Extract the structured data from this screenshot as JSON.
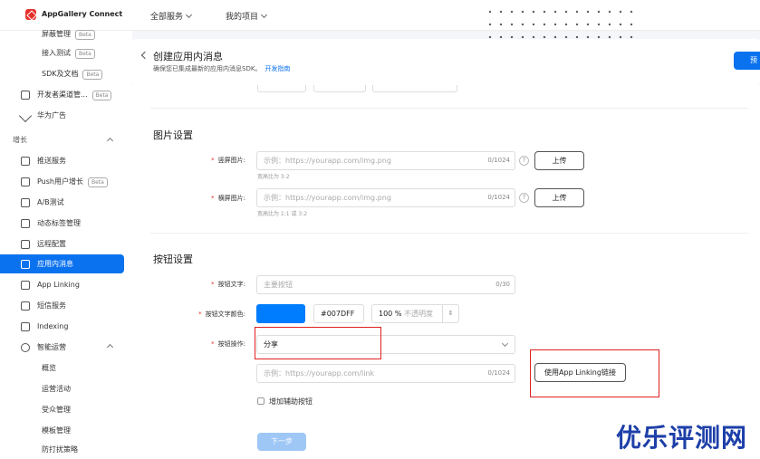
{
  "app": {
    "title": "AppGallery Connect"
  },
  "topnav": {
    "all_services": "全部服务",
    "my_projects": "我的项目"
  },
  "sidebar": {
    "items_top": [
      {
        "label": "屏蔽管理",
        "beta": "Beta"
      },
      {
        "label": "接入测试",
        "beta": "Beta"
      },
      {
        "label": "SDK及文档",
        "beta": "Beta"
      },
      {
        "label": "开发者渠道管...",
        "beta": "Beta"
      },
      {
        "label": "华为广告"
      }
    ],
    "section_growth": "增长",
    "items_growth": [
      {
        "label": "推送服务"
      },
      {
        "label": "Push用户增长",
        "beta": "Beta"
      },
      {
        "label": "A/B测试"
      },
      {
        "label": "动态标签管理"
      },
      {
        "label": "远程配置"
      },
      {
        "label": "应用内消息"
      },
      {
        "label": "App Linking"
      },
      {
        "label": "短信服务"
      },
      {
        "label": "Indexing"
      },
      {
        "label": "智能运营"
      }
    ],
    "items_ops": [
      {
        "label": "概览"
      },
      {
        "label": "运营活动"
      },
      {
        "label": "受众管理"
      },
      {
        "label": "模板管理"
      },
      {
        "label": "防打扰策略"
      }
    ]
  },
  "header": {
    "title": "创建应用内消息",
    "subtitle": "确保您已集成最新的应用内消息SDK。",
    "guide_link": "开发指南",
    "publish": "预"
  },
  "image_settings": {
    "title": "图片设置",
    "portrait_label": "竖屏图片:",
    "portrait_placeholder": "示例：https://yourapp.com/img.png",
    "portrait_count": "0/1024",
    "portrait_hint": "宽高比为 3:2",
    "landscape_label": "横屏图片:",
    "landscape_placeholder": "示例：https://yourapp.com/img.png",
    "landscape_count": "0/1024",
    "landscape_hint": "宽高比为 1:1 或 3:2",
    "upload": "上传",
    "help": "?"
  },
  "button_settings": {
    "title": "按钮设置",
    "text_label": "按钮文字:",
    "text_placeholder": "主要按钮",
    "text_count": "0/30",
    "color_label": "按钮文字颜色:",
    "color_value": "#007DFF",
    "opacity_value": "100",
    "opacity_unit": "%",
    "opacity_hint": "不透明度",
    "action_label": "按钮操作:",
    "action_value": "分享",
    "link_placeholder": "示例：https://yourapp.com/link",
    "link_count": "0/1024",
    "applinking_btn": "使用App Linking链接",
    "aux_checkbox": "增加辅助按钮",
    "next": "下一步"
  },
  "colors": {
    "accent": "#0a72ef",
    "swatch": "#007DFF",
    "highlight": "#e02020"
  },
  "watermark": "优乐评测网"
}
